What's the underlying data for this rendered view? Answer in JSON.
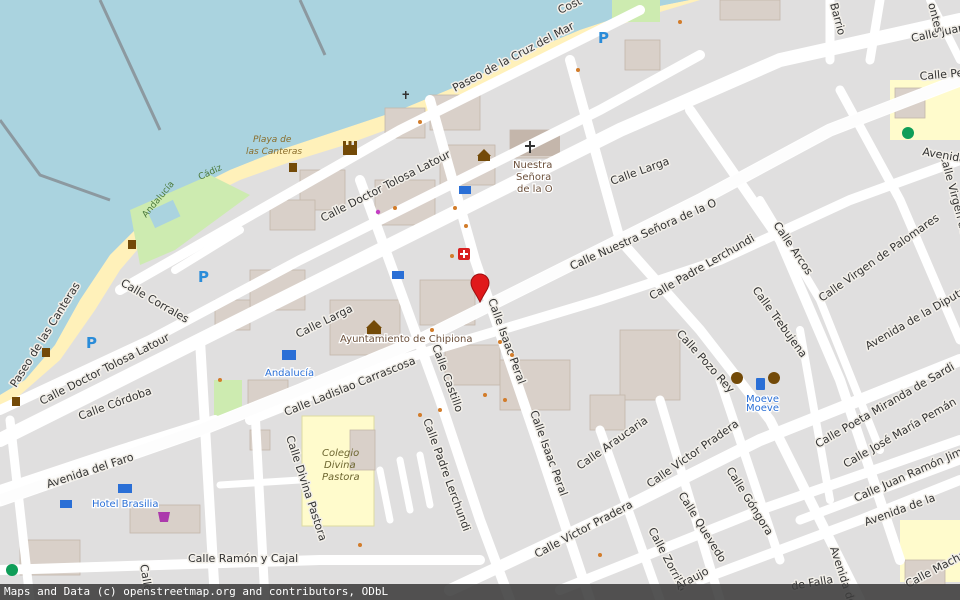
{
  "map": {
    "attribution": "Maps and Data (c) openstreetmap.org and contributors, ODbL",
    "marker": {
      "label": "location-marker"
    },
    "streets": {
      "calle_larga_top": "Calle Larga",
      "calle_larga_mid": "Calle Larga",
      "doctor_tolosa_latour_upper": "Calle Doctor Tolosa Latour",
      "doctor_tolosa_latour_lower": "Calle Doctor Tolosa Latour",
      "paseo_cruz_del_mar": "Paseo de la Cruz del Mar",
      "paseo_las_canteras": "Paseo de las Canteras",
      "calle_corrales": "Calle Corrales",
      "calle_cordoba": "Calle Córdoba",
      "avenida_del_faro": "Avenida del Faro",
      "calle_ramon_y_cajal": "Calle Ramón y Cajal",
      "calle_divina_pastora": "Calle Divina Pastora",
      "calle_ladislao_carrascosa": "Calle Ladislao Carrascosa",
      "calle_castillo": "Calle Castillo",
      "calle_padre_lerchundi_vert": "Calle Padre Lerchundi",
      "calle_padre_lerchundi_diag": "Calle Padre Lerchundi",
      "calle_isaac_peral_upper": "Calle Isaac Peral",
      "calle_isaac_peral_lower": "Calle Isaac Peral",
      "calle_nuestra_senora": "Calle Nuestra Señora de la O",
      "calle_araucaria": "Calle Araucaria",
      "calle_victor_pradera_upper": "Calle Víctor Pradera",
      "calle_victor_pradera_lower": "Calle Víctor Pradera",
      "calle_quevedo": "Calle Quevedo",
      "calle_gongora": "Calle Góngora",
      "calle_zorrilla": "Calle Zorrilla",
      "calle_pozo_rey": "Calle Pozo Rey",
      "calle_trebujena": "Calle Trebujena",
      "calle_arcos": "Calle Arcos",
      "calle_virgen_palomares": "Calle Virgen de Palomares",
      "calle_virgen_de_top": "Calle Virgen de",
      "avenida_diputacion": "Avenida de la Diputación",
      "calle_poeta_miranda": "Calle Poeta Miranda de Sardi",
      "calle_jose_maria_peman": "Calle José María Pemán",
      "calle_juan_ramon_jimenez": "Calle Juan Ramón Jiménez",
      "avenida_de_la": "Avenida de la",
      "calle_juan_top": "Calle Juan",
      "calle_pe_top": "Calle Pe",
      "avenida_right": "Avenida",
      "barrio": "Barrio",
      "ontes": "ontes",
      "araujo": "Araujo",
      "de_falla": "de Falla",
      "avenida_de_ro": "Avenida de Ro",
      "calle_macha": "Calle Macha",
      "calle_cut_left": "Calle",
      "costa_cut": "Cost"
    },
    "pois": {
      "nuestra_senora_1": "Nuestra",
      "nuestra_senora_2": "Señora",
      "nuestra_senora_3": "de la O",
      "ayuntamiento": "Ayuntamiento de Chipiona",
      "andalucia": "Andalucía",
      "moeve_1": "Moeve",
      "moeve_2": "Moeve",
      "hotel_brasilia": "Hotel Brasilia",
      "colegio_1": "Colegio",
      "colegio_2": "Divina",
      "colegio_3": "Pastora",
      "playa_1": "Playa de",
      "playa_2": "las Canteras",
      "cadiz": "Cádiz",
      "andalucia_park": "Andalucía"
    },
    "parking_label": "P",
    "colors": {
      "sea": "#aad3df",
      "beach": "#fff1ba",
      "land": "#f2efe9",
      "residential": "#e0dfdf",
      "building": "#d9d0c9",
      "road": "#ffffff",
      "park": "#cdebb0",
      "school": "#fffbcc",
      "marker": "#e0191b",
      "parking": "#2a8cd9"
    }
  }
}
